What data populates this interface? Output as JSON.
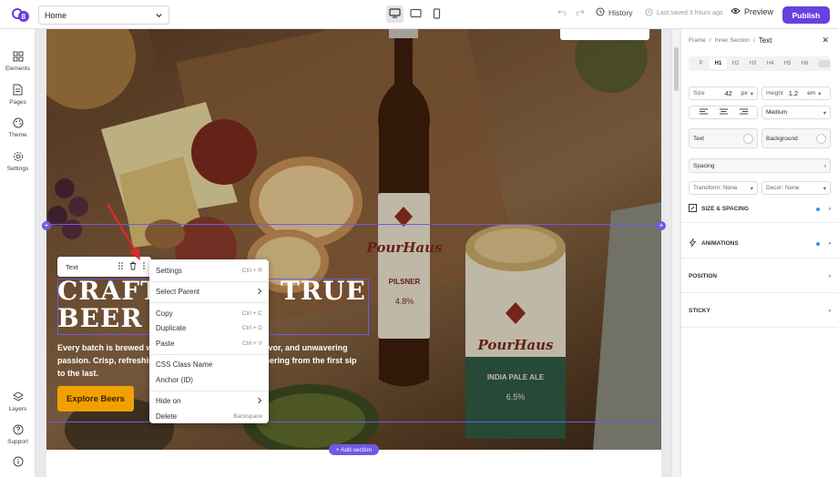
{
  "topbar": {
    "page_select": "Home",
    "history_label": "History",
    "last_saved": "Last saved 3 hours ago",
    "preview_label": "Preview",
    "publish_label": "Publish",
    "logo_icon": "brand-logo-icon",
    "brand_color": "#6840e0"
  },
  "sidebar": {
    "items": [
      {
        "label": "Elements",
        "icon": "grid-icon"
      },
      {
        "label": "Pages",
        "icon": "page-icon"
      },
      {
        "label": "Theme",
        "icon": "palette-icon"
      },
      {
        "label": "Settings",
        "icon": "gear-icon"
      }
    ],
    "bottom": [
      {
        "label": "Layers",
        "icon": "layers-icon"
      },
      {
        "label": "Support",
        "icon": "help-icon"
      }
    ]
  },
  "canvas": {
    "hero_title": "CRAFTED WITH TRUE BEER LOVE",
    "hero_title_lines": [
      "CRAFT",
      "BEER L"
    ],
    "hero_title_visible_right": "TRUE",
    "hero_body_l1a": "Every batch is brewed w",
    "hero_body_l1b": "avor, and unwavering",
    "hero_body_l2a": "passion. Crisp, refreshin",
    "hero_body_l2b": "thering from the first sip",
    "hero_body_l3": "to the last.",
    "explore_button": "Explore Beers",
    "add_section": "+ Add section",
    "accent_color": "#f0a000"
  },
  "text_toolbar": {
    "label": "Text"
  },
  "context_menu": {
    "items": [
      {
        "label": "Settings",
        "shortcut": "Ctrl + R"
      },
      {
        "label": "Select Parent",
        "shortcut": ">"
      },
      {
        "label": "Copy",
        "shortcut": "Ctrl + C"
      },
      {
        "label": "Duplicate",
        "shortcut": "Ctrl + D"
      },
      {
        "label": "Paste",
        "shortcut": "Ctrl + V"
      },
      {
        "label": "CSS Class Name",
        "shortcut": ""
      },
      {
        "label": "Anchor (ID)",
        "shortcut": ""
      },
      {
        "label": "Hide on",
        "shortcut": ">"
      },
      {
        "label": "Delete",
        "shortcut": "Backspace"
      }
    ]
  },
  "right_panel": {
    "breadcrumb": [
      "Frame",
      "Inner Section",
      "Text"
    ],
    "heading_tags": [
      "P",
      "H1",
      "H2",
      "H3",
      "H4",
      "H5",
      "H6"
    ],
    "active_tag": "H1",
    "size_label": "Size",
    "size_value": "42",
    "size_unit": "px",
    "height_label": "Height",
    "height_value": "1.2",
    "height_unit": "em",
    "weight": "Medium",
    "text_label": "Text",
    "background_label": "Background",
    "spacing_label": "Spacing",
    "transform": "Transform: None",
    "decor": "Decor: None",
    "sections": [
      "SIZE & SPACING",
      "ANIMATIONS",
      "POSITION",
      "STICKY"
    ]
  }
}
